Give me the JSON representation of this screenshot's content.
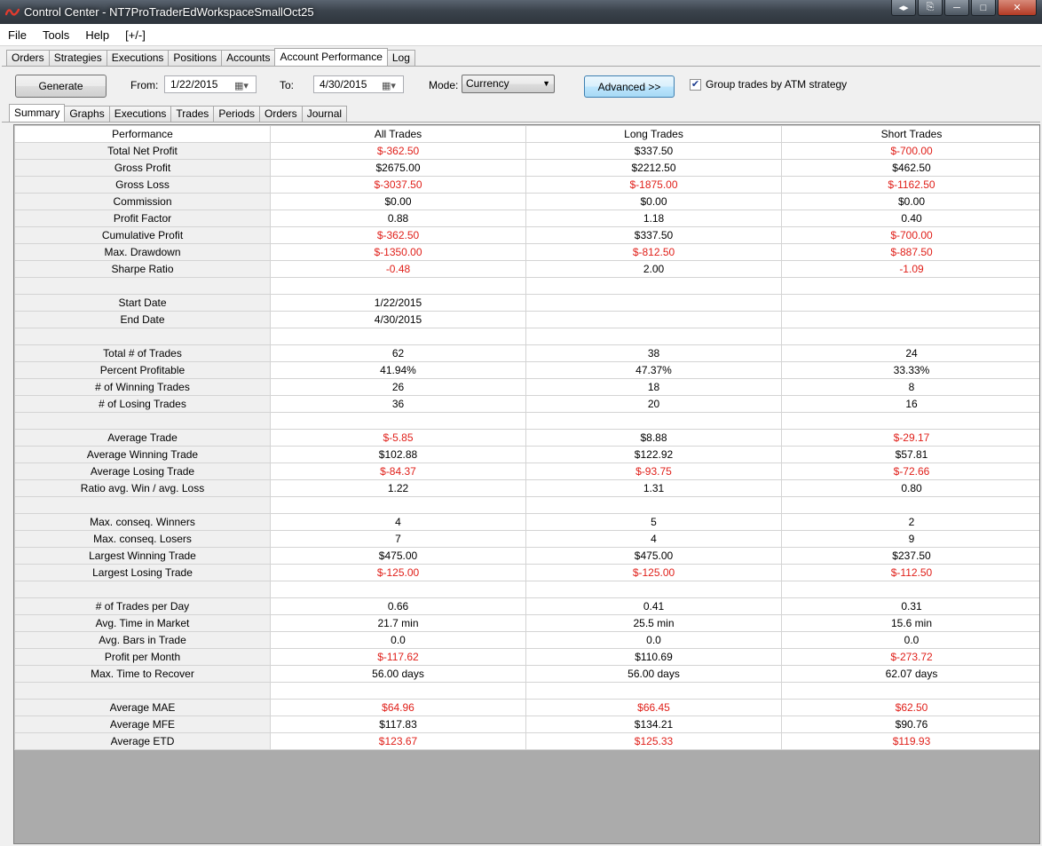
{
  "window": {
    "title": "Control Center - NT7ProTraderEdWorkspaceSmallOct25"
  },
  "menu": [
    "File",
    "Tools",
    "Help",
    "[+/-]"
  ],
  "main_tabs": [
    "Orders",
    "Strategies",
    "Executions",
    "Positions",
    "Accounts",
    "Account Performance",
    "Log"
  ],
  "active_main_tab": "Account Performance",
  "toolbar": {
    "generate_label": "Generate",
    "from_label": "From:",
    "from_value": "1/22/2015",
    "to_label": "To:",
    "to_value": "4/30/2015",
    "mode_label": "Mode:",
    "mode_value": "Currency",
    "advanced_label": "Advanced >>",
    "group_label": "Group trades by ATM strategy",
    "group_checked": true
  },
  "sub_tabs": [
    "Summary",
    "Graphs",
    "Executions",
    "Trades",
    "Periods",
    "Orders",
    "Journal"
  ],
  "active_sub_tab": "Summary",
  "colors": {
    "negative": "#e0201a"
  },
  "table": {
    "headers": [
      "Performance",
      "All Trades",
      "Long Trades",
      "Short Trades"
    ],
    "rows": [
      [
        "Total Net Profit",
        "$-362.50",
        "$337.50",
        "$-700.00"
      ],
      [
        "Gross Profit",
        "$2675.00",
        "$2212.50",
        "$462.50"
      ],
      [
        "Gross Loss",
        "$-3037.50",
        "$-1875.00",
        "$-1162.50"
      ],
      [
        "Commission",
        "$0.00",
        "$0.00",
        "$0.00"
      ],
      [
        "Profit Factor",
        "0.88",
        "1.18",
        "0.40"
      ],
      [
        "Cumulative Profit",
        "$-362.50",
        "$337.50",
        "$-700.00"
      ],
      [
        "Max. Drawdown",
        "$-1350.00",
        "$-812.50",
        "$-887.50"
      ],
      [
        "Sharpe Ratio",
        "-0.48",
        "2.00",
        "-1.09"
      ],
      [
        "",
        "",
        "",
        ""
      ],
      [
        "Start Date",
        "1/22/2015",
        "",
        ""
      ],
      [
        "End Date",
        "4/30/2015",
        "",
        ""
      ],
      [
        "",
        "",
        "",
        ""
      ],
      [
        "Total # of Trades",
        "62",
        "38",
        "24"
      ],
      [
        "Percent Profitable",
        "41.94%",
        "47.37%",
        "33.33%"
      ],
      [
        "# of Winning Trades",
        "26",
        "18",
        "8"
      ],
      [
        "# of Losing Trades",
        "36",
        "20",
        "16"
      ],
      [
        "",
        "",
        "",
        ""
      ],
      [
        "Average Trade",
        "$-5.85",
        "$8.88",
        "$-29.17"
      ],
      [
        "Average Winning Trade",
        "$102.88",
        "$122.92",
        "$57.81"
      ],
      [
        "Average Losing Trade",
        "$-84.37",
        "$-93.75",
        "$-72.66"
      ],
      [
        "Ratio avg. Win / avg. Loss",
        "1.22",
        "1.31",
        "0.80"
      ],
      [
        "",
        "",
        "",
        ""
      ],
      [
        "Max. conseq. Winners",
        "4",
        "5",
        "2"
      ],
      [
        "Max. conseq. Losers",
        "7",
        "4",
        "9"
      ],
      [
        "Largest Winning Trade",
        "$475.00",
        "$475.00",
        "$237.50"
      ],
      [
        "Largest Losing Trade",
        "$-125.00",
        "$-125.00",
        "$-112.50"
      ],
      [
        "",
        "",
        "",
        ""
      ],
      [
        "# of Trades per Day",
        "0.66",
        "0.41",
        "0.31"
      ],
      [
        "Avg. Time in Market",
        "21.7 min",
        "25.5 min",
        "15.6 min"
      ],
      [
        "Avg. Bars in Trade",
        "0.0",
        "0.0",
        "0.0"
      ],
      [
        "Profit per Month",
        "$-117.62",
        "$110.69",
        "$-273.72"
      ],
      [
        "Max. Time to Recover",
        "56.00 days",
        "56.00 days",
        "62.07 days"
      ],
      [
        "",
        "",
        "",
        ""
      ],
      [
        "Average MAE",
        "$64.96",
        "$66.45",
        "$62.50"
      ],
      [
        "Average MFE",
        "$117.83",
        "$134.21",
        "$90.76"
      ],
      [
        "Average ETD",
        "$123.67",
        "$125.33",
        "$119.93"
      ]
    ],
    "red_cells": [
      "0.1",
      "0.3",
      "2.1",
      "2.2",
      "2.3",
      "5.1",
      "5.3",
      "6.1",
      "6.2",
      "6.3",
      "7.1",
      "7.3",
      "17.1",
      "17.3",
      "19.1",
      "19.2",
      "19.3",
      "25.1",
      "25.2",
      "25.3",
      "30.1",
      "30.3",
      "33.1",
      "33.2",
      "33.3",
      "35.1",
      "35.2",
      "35.3"
    ]
  }
}
